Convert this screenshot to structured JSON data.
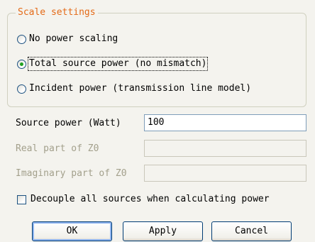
{
  "scale_settings": {
    "title": "Scale settings",
    "options": [
      {
        "label": "No power scaling",
        "checked": false
      },
      {
        "label": "Total source power (no mismatch)",
        "checked": true
      },
      {
        "label": "Incident power (transmission line model)",
        "checked": false
      }
    ]
  },
  "fields": {
    "source_power": {
      "label": "Source power (Watt)",
      "value": "100"
    },
    "real_z0": {
      "label": "Real part of Z0",
      "value": ""
    },
    "imag_z0": {
      "label": "Imaginary part of Z0",
      "value": ""
    }
  },
  "decouple_checkbox": {
    "label": "Decouple all sources when calculating power",
    "checked": false
  },
  "buttons": {
    "ok": "OK",
    "apply": "Apply",
    "cancel": "Cancel"
  },
  "colors": {
    "group_title": "#e46a17",
    "disabled_text": "#a3a08c",
    "radio_dot": "#21a121"
  }
}
